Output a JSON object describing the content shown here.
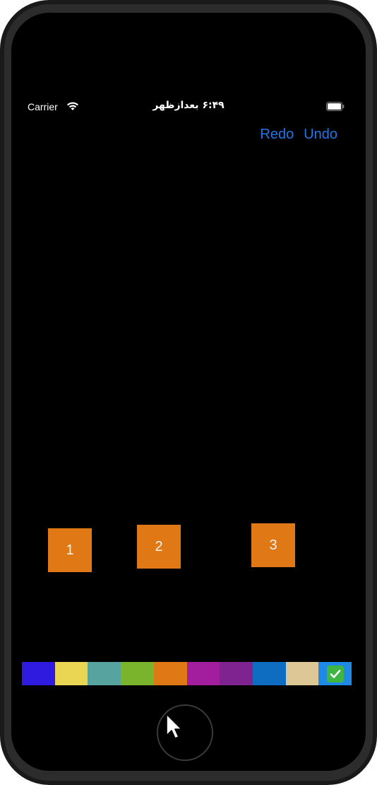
{
  "status_bar": {
    "carrier": "Carrier",
    "time": "۶:۴۹ بعدازظهر",
    "wifi_icon": "wifi-icon",
    "battery_icon": "battery-icon"
  },
  "nav": {
    "redo_label": "Redo",
    "undo_label": "Undo",
    "accent_color": "#1f75e8"
  },
  "boxes": [
    {
      "label": "1",
      "color": "#e07815"
    },
    {
      "label": "2",
      "color": "#e07815"
    },
    {
      "label": "3",
      "color": "#e07815"
    }
  ],
  "palette": {
    "colors": [
      "#2f1be0",
      "#ead653",
      "#56a3a0",
      "#7ab32c",
      "#e07815",
      "#a31e9f",
      "#7f2390",
      "#0e6cc1",
      "#ddc797",
      "#1e8ae6"
    ],
    "selected_index": 9,
    "selected_icon": "check-icon"
  }
}
